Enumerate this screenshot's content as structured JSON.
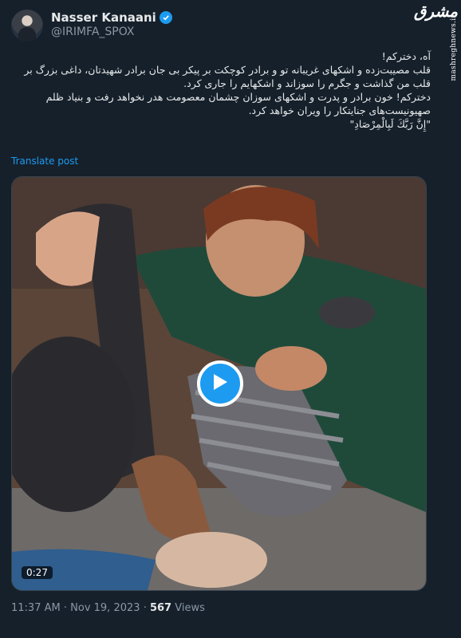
{
  "author": {
    "name": "Nasser Kanaani",
    "handle": "@IRIMFA_SPOX",
    "verified": true
  },
  "watermark": {
    "logo": "مشرق",
    "url": "mashreghnews.ir"
  },
  "tweet": {
    "lines": [
      "آه، دخترکم!",
      "قلب مصیبت‌زده و اشکهای غریبانه تو و برادر کوچکت بر پیکر بی جان برادر شهیدتان، داغی بزرگ بر",
      "قلب من گذاشت و جگرم را سوزاند و اشکهایم را جاری کرد.",
      "دخترکم! خون برادر و پدرت و اشکهای سوزان چشمان معصومت هدر نخواهد رفت و بنیاد ظلم",
      "صهیونیست‌های جنایتکار را ویران خواهد کرد.",
      "\"إِنَّ رَبَّكَ لَبِالْمِرْصَادِ\""
    ],
    "translate_label": "Translate post"
  },
  "media": {
    "duration": "0:27",
    "play_icon": "play-icon"
  },
  "meta": {
    "time": "11:37 AM",
    "separator": "·",
    "date": "Nov 19, 2023",
    "views_count": "567",
    "views_label": "Views"
  },
  "colors": {
    "background": "#15202b",
    "accent": "#1d9bf0",
    "text": "#e7e9ea",
    "muted": "#8b98a5"
  }
}
